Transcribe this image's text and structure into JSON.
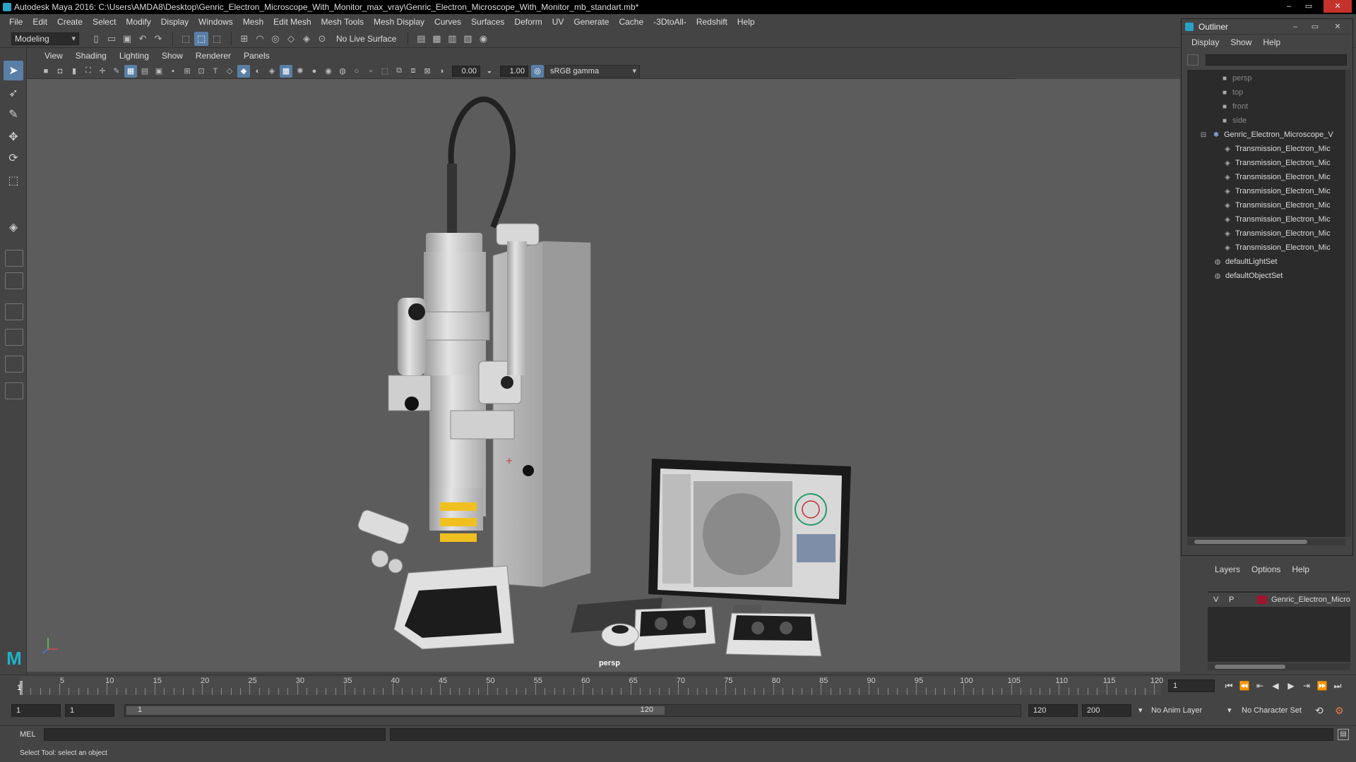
{
  "window": {
    "title": "Autodesk Maya 2016: C:\\Users\\AMDA8\\Desktop\\Genric_Electron_Microscope_With_Monitor_max_vray\\Genric_Electron_Microscope_With_Monitor_mb_standart.mb*",
    "controls": {
      "minimize": "–",
      "maximize": "▭",
      "close": "✕"
    }
  },
  "menubar": [
    "File",
    "Edit",
    "Create",
    "Select",
    "Modify",
    "Display",
    "Windows",
    "Mesh",
    "Edit Mesh",
    "Mesh Tools",
    "Mesh Display",
    "Curves",
    "Surfaces",
    "Deform",
    "UV",
    "Generate",
    "Cache",
    "-3DtoAll-",
    "Redshift",
    "Help"
  ],
  "toolbar": {
    "mode": "Modeling",
    "live_surface": "No Live Surface"
  },
  "viewport": {
    "panel_menu": [
      "View",
      "Shading",
      "Lighting",
      "Show",
      "Renderer",
      "Panels"
    ],
    "exposure": "0.00",
    "gamma": "1.00",
    "color_space": "sRGB gamma",
    "camera_label": "persp"
  },
  "outliner": {
    "title": "Outliner",
    "menu": [
      "Display",
      "Show",
      "Help"
    ],
    "items": [
      {
        "label": "persp",
        "type": "camera"
      },
      {
        "label": "top",
        "type": "camera"
      },
      {
        "label": "front",
        "type": "camera"
      },
      {
        "label": "side",
        "type": "camera"
      },
      {
        "label": "Genric_Electron_Microscope_V",
        "type": "group"
      },
      {
        "label": "Transmission_Electron_Mic",
        "type": "mesh"
      },
      {
        "label": "Transmission_Electron_Mic",
        "type": "mesh"
      },
      {
        "label": "Transmission_Electron_Mic",
        "type": "mesh"
      },
      {
        "label": "Transmission_Electron_Mic",
        "type": "mesh"
      },
      {
        "label": "Transmission_Electron_Mic",
        "type": "mesh"
      },
      {
        "label": "Transmission_Electron_Mic",
        "type": "mesh"
      },
      {
        "label": "Transmission_Electron_Mic",
        "type": "mesh"
      },
      {
        "label": "Transmission_Electron_Mic",
        "type": "mesh"
      },
      {
        "label": "defaultLightSet",
        "type": "set"
      },
      {
        "label": "defaultObjectSet",
        "type": "set"
      }
    ]
  },
  "layers": {
    "menu": [
      "Layers",
      "Options",
      "Help"
    ],
    "row": {
      "visible": "V",
      "playback": "P",
      "name": "Genric_Electron_Micro",
      "color": "#a0142c"
    }
  },
  "timeline": {
    "ticks": [
      "5",
      "10",
      "15",
      "20",
      "25",
      "30",
      "35",
      "40",
      "45",
      "50",
      "55",
      "60",
      "65",
      "70",
      "75",
      "80",
      "85",
      "90",
      "95",
      "100",
      "105",
      "110",
      "115",
      "120"
    ],
    "current_frame_mark": "1",
    "current_frame": "1"
  },
  "range": {
    "start": "1",
    "playback_start": "1",
    "slider_start": "1",
    "slider_end": "120",
    "playback_end": "120",
    "end": "200",
    "anim_layer": "No Anim Layer",
    "character_set": "No Character Set"
  },
  "cmdline": {
    "label": "MEL"
  },
  "helpline": {
    "text": "Select Tool: select an object"
  }
}
